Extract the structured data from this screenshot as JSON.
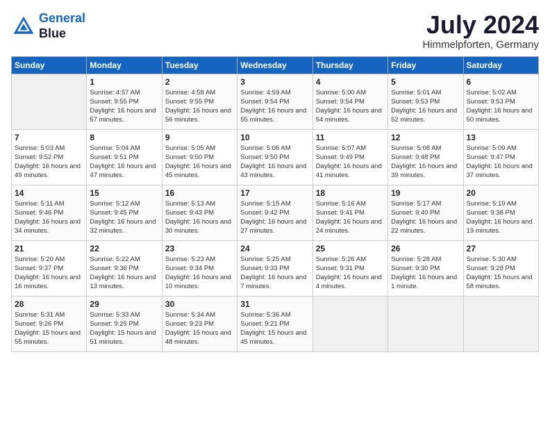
{
  "header": {
    "logo_line1": "General",
    "logo_line2": "Blue",
    "month": "July 2024",
    "location": "Himmelpforten, Germany"
  },
  "weekdays": [
    "Sunday",
    "Monday",
    "Tuesday",
    "Wednesday",
    "Thursday",
    "Friday",
    "Saturday"
  ],
  "weeks": [
    [
      {
        "day": "",
        "empty": true
      },
      {
        "day": "1",
        "sunrise": "4:57 AM",
        "sunset": "9:55 PM",
        "daylight": "16 hours and 57 minutes."
      },
      {
        "day": "2",
        "sunrise": "4:58 AM",
        "sunset": "9:55 PM",
        "daylight": "16 hours and 56 minutes."
      },
      {
        "day": "3",
        "sunrise": "4:59 AM",
        "sunset": "9:54 PM",
        "daylight": "16 hours and 55 minutes."
      },
      {
        "day": "4",
        "sunrise": "5:00 AM",
        "sunset": "9:54 PM",
        "daylight": "16 hours and 54 minutes."
      },
      {
        "day": "5",
        "sunrise": "5:01 AM",
        "sunset": "9:53 PM",
        "daylight": "16 hours and 52 minutes."
      },
      {
        "day": "6",
        "sunrise": "5:02 AM",
        "sunset": "9:53 PM",
        "daylight": "16 hours and 50 minutes."
      }
    ],
    [
      {
        "day": "7",
        "sunrise": "5:03 AM",
        "sunset": "9:52 PM",
        "daylight": "16 hours and 49 minutes."
      },
      {
        "day": "8",
        "sunrise": "5:04 AM",
        "sunset": "9:51 PM",
        "daylight": "16 hours and 47 minutes."
      },
      {
        "day": "9",
        "sunrise": "5:05 AM",
        "sunset": "9:50 PM",
        "daylight": "16 hours and 45 minutes."
      },
      {
        "day": "10",
        "sunrise": "5:06 AM",
        "sunset": "9:50 PM",
        "daylight": "16 hours and 43 minutes."
      },
      {
        "day": "11",
        "sunrise": "5:07 AM",
        "sunset": "9:49 PM",
        "daylight": "16 hours and 41 minutes."
      },
      {
        "day": "12",
        "sunrise": "5:08 AM",
        "sunset": "9:48 PM",
        "daylight": "16 hours and 39 minutes."
      },
      {
        "day": "13",
        "sunrise": "5:09 AM",
        "sunset": "9:47 PM",
        "daylight": "16 hours and 37 minutes."
      }
    ],
    [
      {
        "day": "14",
        "sunrise": "5:11 AM",
        "sunset": "9:46 PM",
        "daylight": "16 hours and 34 minutes."
      },
      {
        "day": "15",
        "sunrise": "5:12 AM",
        "sunset": "9:45 PM",
        "daylight": "16 hours and 32 minutes."
      },
      {
        "day": "16",
        "sunrise": "5:13 AM",
        "sunset": "9:43 PM",
        "daylight": "16 hours and 30 minutes."
      },
      {
        "day": "17",
        "sunrise": "5:15 AM",
        "sunset": "9:42 PM",
        "daylight": "16 hours and 27 minutes."
      },
      {
        "day": "18",
        "sunrise": "5:16 AM",
        "sunset": "9:41 PM",
        "daylight": "16 hours and 24 minutes."
      },
      {
        "day": "19",
        "sunrise": "5:17 AM",
        "sunset": "9:40 PM",
        "daylight": "16 hours and 22 minutes."
      },
      {
        "day": "20",
        "sunrise": "5:19 AM",
        "sunset": "9:38 PM",
        "daylight": "16 hours and 19 minutes."
      }
    ],
    [
      {
        "day": "21",
        "sunrise": "5:20 AM",
        "sunset": "9:37 PM",
        "daylight": "16 hours and 16 minutes."
      },
      {
        "day": "22",
        "sunrise": "5:22 AM",
        "sunset": "9:36 PM",
        "daylight": "16 hours and 13 minutes."
      },
      {
        "day": "23",
        "sunrise": "5:23 AM",
        "sunset": "9:34 PM",
        "daylight": "16 hours and 10 minutes."
      },
      {
        "day": "24",
        "sunrise": "5:25 AM",
        "sunset": "9:33 PM",
        "daylight": "16 hours and 7 minutes."
      },
      {
        "day": "25",
        "sunrise": "5:26 AM",
        "sunset": "9:31 PM",
        "daylight": "16 hours and 4 minutes."
      },
      {
        "day": "26",
        "sunrise": "5:28 AM",
        "sunset": "9:30 PM",
        "daylight": "16 hours and 1 minute."
      },
      {
        "day": "27",
        "sunrise": "5:30 AM",
        "sunset": "9:28 PM",
        "daylight": "15 hours and 58 minutes."
      }
    ],
    [
      {
        "day": "28",
        "sunrise": "5:31 AM",
        "sunset": "9:26 PM",
        "daylight": "15 hours and 55 minutes."
      },
      {
        "day": "29",
        "sunrise": "5:33 AM",
        "sunset": "9:25 PM",
        "daylight": "15 hours and 51 minutes."
      },
      {
        "day": "30",
        "sunrise": "5:34 AM",
        "sunset": "9:23 PM",
        "daylight": "15 hours and 48 minutes."
      },
      {
        "day": "31",
        "sunrise": "5:36 AM",
        "sunset": "9:21 PM",
        "daylight": "15 hours and 45 minutes."
      },
      {
        "day": "",
        "empty": true
      },
      {
        "day": "",
        "empty": true
      },
      {
        "day": "",
        "empty": true
      }
    ]
  ]
}
